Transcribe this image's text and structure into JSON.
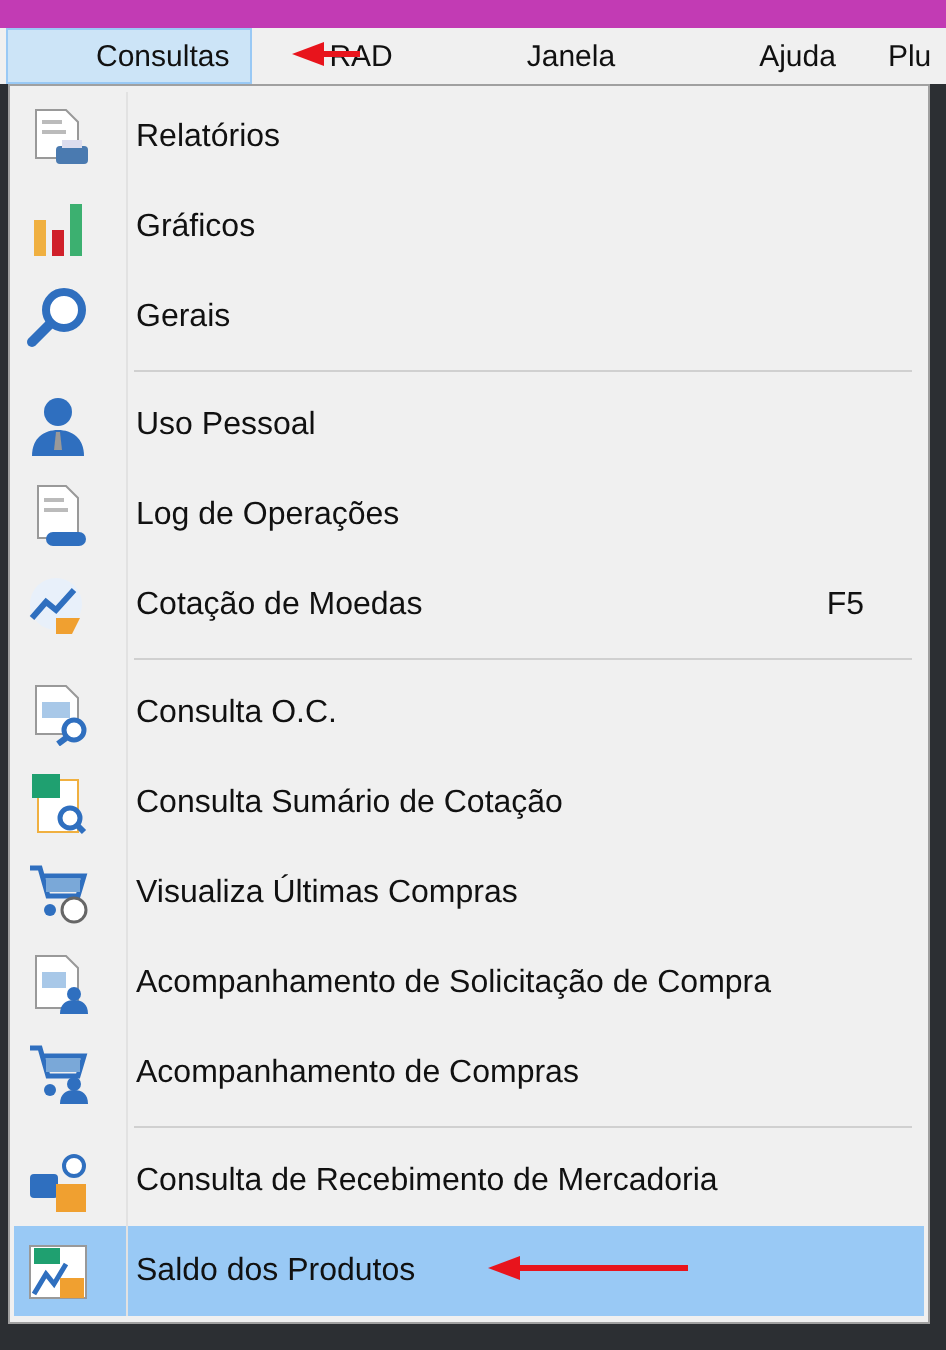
{
  "menubar": [
    {
      "label": "Consultas",
      "selected": true
    },
    {
      "label": "RAD",
      "selected": false
    },
    {
      "label": "Janela",
      "selected": false
    },
    {
      "label": "Ajuda",
      "selected": false
    },
    {
      "label": "Plu",
      "selected": false
    }
  ],
  "menu": {
    "groups": [
      {
        "items": [
          {
            "label": "Relatórios",
            "selected": false
          },
          {
            "label": "Gráficos",
            "selected": false
          },
          {
            "label": "Gerais",
            "selected": false
          }
        ]
      },
      {
        "items": [
          {
            "label": "Uso Pessoal",
            "selected": false
          },
          {
            "label": "Log de Operações",
            "selected": false
          },
          {
            "label": "Cotação de Moedas",
            "shortcut": "F5",
            "selected": false
          }
        ]
      },
      {
        "items": [
          {
            "label": "Consulta O.C.",
            "selected": false
          },
          {
            "label": "Consulta Sumário de Cotação",
            "selected": false
          },
          {
            "label": "Visualiza Últimas Compras",
            "selected": false
          },
          {
            "label": "Acompanhamento de Solicitação de Compra",
            "selected": false
          },
          {
            "label": "Acompanhamento de Compras",
            "selected": false
          }
        ]
      },
      {
        "items": [
          {
            "label": "Consulta de Recebimento de Mercadoria",
            "selected": false
          },
          {
            "label": "Saldo dos Produtos",
            "selected": true
          }
        ]
      }
    ]
  }
}
